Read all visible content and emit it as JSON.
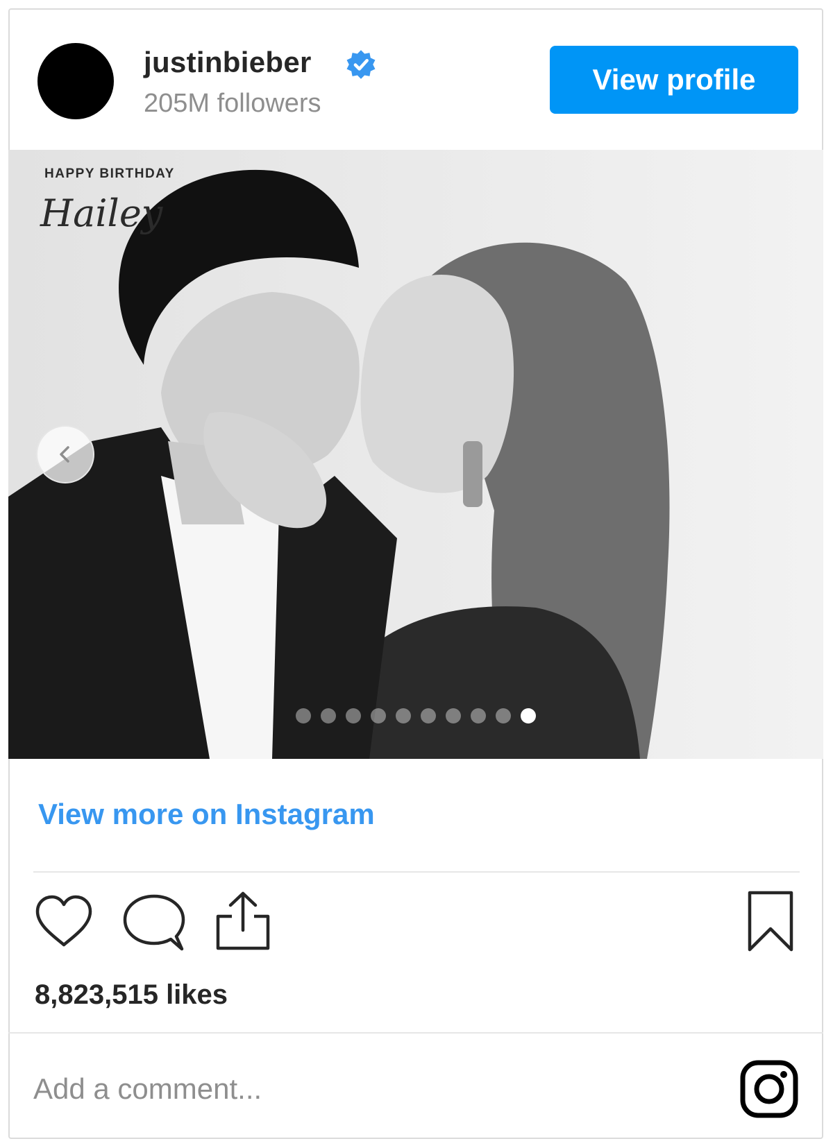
{
  "header": {
    "username": "justinbieber",
    "followers": "205M followers",
    "view_profile_label": "View profile"
  },
  "photo": {
    "overlay_line1": "HAPPY BIRTHDAY",
    "overlay_line2": "Hailey",
    "carousel_count": 10,
    "carousel_active_index": 10
  },
  "view_more_label": "View more on Instagram",
  "likes": "8,823,515 likes",
  "comment": {
    "placeholder": "Add a comment..."
  },
  "icons": [
    "verified-badge-icon",
    "chevron-left-icon",
    "heart-icon",
    "comment-icon",
    "share-icon",
    "bookmark-icon",
    "instagram-icon"
  ],
  "colors": {
    "primary_button": "#0095f6",
    "link": "#3897f0",
    "text": "#262626",
    "muted": "#8e8e8e"
  }
}
